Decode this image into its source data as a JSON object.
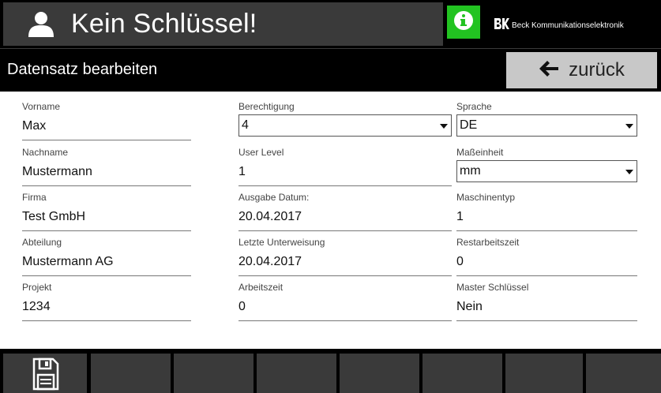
{
  "header": {
    "title": "Kein Schlüssel!",
    "user_icon": "user-icon",
    "info_icon": "info-icon",
    "brand_logo": "BK",
    "brand_name": "Beck Kommunikationselektronik",
    "colors": {
      "info_button": "#22c321",
      "title_background": "#3a3a3a",
      "bar_background": "#000000"
    }
  },
  "subheader": {
    "title": "Datensatz bearbeiten",
    "back_label": "zurück",
    "back_icon": "arrow-left-icon",
    "back_button_color": "#c8c8c8"
  },
  "form": {
    "vorname": {
      "label": "Vorname",
      "value": "Max"
    },
    "nachname": {
      "label": "Nachname",
      "value": "Mustermann"
    },
    "firma": {
      "label": "Firma",
      "value": "Test GmbH"
    },
    "abteilung": {
      "label": "Abteilung",
      "value": "Mustermann AG"
    },
    "projekt": {
      "label": "Projekt",
      "value": "1234"
    },
    "berechtigung": {
      "label": "Berechtigung",
      "value": "4"
    },
    "user_level": {
      "label": "User Level",
      "value": "1"
    },
    "ausgabe_datum": {
      "label": "Ausgabe Datum:",
      "value": "20.04.2017"
    },
    "letzte_unterweisung": {
      "label": "Letzte Unterweisung",
      "value": "20.04.2017"
    },
    "arbeitszeit": {
      "label": "Arbeitszeit",
      "value": "0"
    },
    "sprache": {
      "label": "Sprache",
      "value": "DE"
    },
    "masseinheit": {
      "label": "Maßeinheit",
      "value": "mm"
    },
    "maschinentyp": {
      "label": "Maschinentyp",
      "value": "1"
    },
    "restarbeitszeit": {
      "label": "Restarbeitszeit",
      "value": "0"
    },
    "master_schluessel": {
      "label": "Master Schlüssel",
      "value": "Nein"
    }
  },
  "footer": {
    "save_icon": "save-icon",
    "button_count": 8
  }
}
